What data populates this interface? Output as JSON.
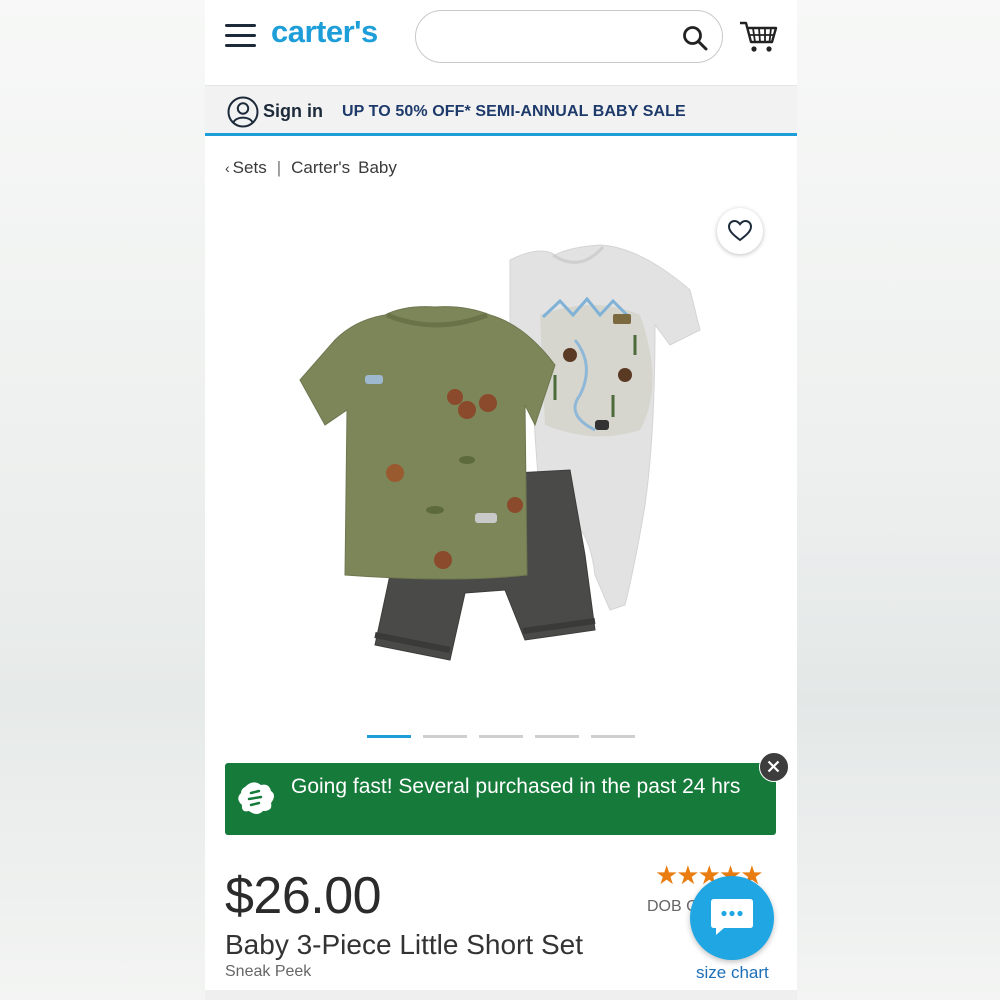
{
  "header": {
    "logo": "carter's",
    "search": {
      "value": "",
      "placeholder": ""
    }
  },
  "promo_bar": {
    "signin_label": "Sign in",
    "promo_text": "UP TO 50% OFF* SEMI-ANNUAL BABY SALE"
  },
  "breadcrumb": {
    "back_label": "Sets",
    "items": [
      "Carter's",
      "Baby"
    ]
  },
  "gallery": {
    "total_slides": 5,
    "active_slide": 1
  },
  "alert": {
    "message": "Going fast! Several purchased in the past 24 hrs"
  },
  "product": {
    "price": "$26.00",
    "title": "Baby 3-Piece Little Short Set",
    "subtitle": "Sneak Peek",
    "rating_stars": "★★★★★",
    "rating_value": 5,
    "dob_text": "DOB C",
    "size_chart_label": "size chart"
  },
  "colors": {
    "brand_blue": "#1d9ed8",
    "alert_green": "#157a3a",
    "star_orange": "#e97d12",
    "chat_blue": "#1fa6e3"
  },
  "icons": [
    "menu-icon",
    "search-icon",
    "cart-icon",
    "user-icon",
    "heart-icon",
    "bolt-icon",
    "close-icon",
    "chat-icon"
  ]
}
